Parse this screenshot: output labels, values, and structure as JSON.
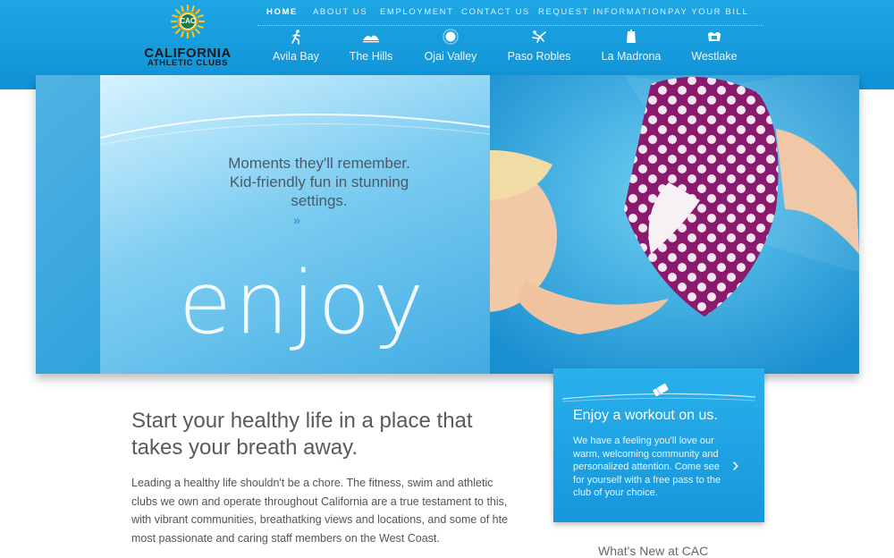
{
  "brand": {
    "monogram": "CAC",
    "name_line1": "CALIFORNIA",
    "name_line2": "ATHLETIC CLUBS"
  },
  "top_nav": [
    {
      "label": "HOME",
      "active": true
    },
    {
      "label": "ABOUT US",
      "active": false
    },
    {
      "label": "EMPLOYMENT",
      "active": false
    },
    {
      "label": "CONTACT US",
      "active": false
    },
    {
      "label": "REQUEST INFORMATION",
      "active": false
    },
    {
      "label": "PAY YOUR BILL",
      "active": false
    }
  ],
  "clubs": [
    {
      "label": "Avila Bay",
      "icon": "runner-icon"
    },
    {
      "label": "The Hills",
      "icon": "hills-icon"
    },
    {
      "label": "Ojai Valley",
      "icon": "sun-icon"
    },
    {
      "label": "Paso Robles",
      "icon": "gymnast-icon"
    },
    {
      "label": "La Madrona",
      "icon": "building-icon"
    },
    {
      "label": "Westlake",
      "icon": "lotus-icon"
    }
  ],
  "hero": {
    "tagline_line1": "Moments they'll remember.",
    "tagline_line2": "Kid-friendly fun in stunning",
    "tagline_line3": "settings.",
    "more": "»",
    "word": "enjoy"
  },
  "main": {
    "headline": "Start your healthy life in a place that takes your breath away.",
    "body": "Leading a healthy life shouldn't be a chore. The fitness, swim and athletic clubs we own and operate throughout California are a true testament to this, with vibrant communities, breathatking views and locations, and some of hte most passionate and caring staff members on the West Coast."
  },
  "promo": {
    "icon": "ticket-icon",
    "title": "Enjoy a workout on us.",
    "text": "We have a feeling you'll love our warm, welcoming community and personalized attention. Come see for yourself with a free pass to the club of your choice.",
    "arrow": "›"
  },
  "news": {
    "heading": "What's New at CAC"
  },
  "colors": {
    "header_blue": "#1ea6e4",
    "promo_blue": "#2ab0ec",
    "text_gray": "#555555"
  }
}
